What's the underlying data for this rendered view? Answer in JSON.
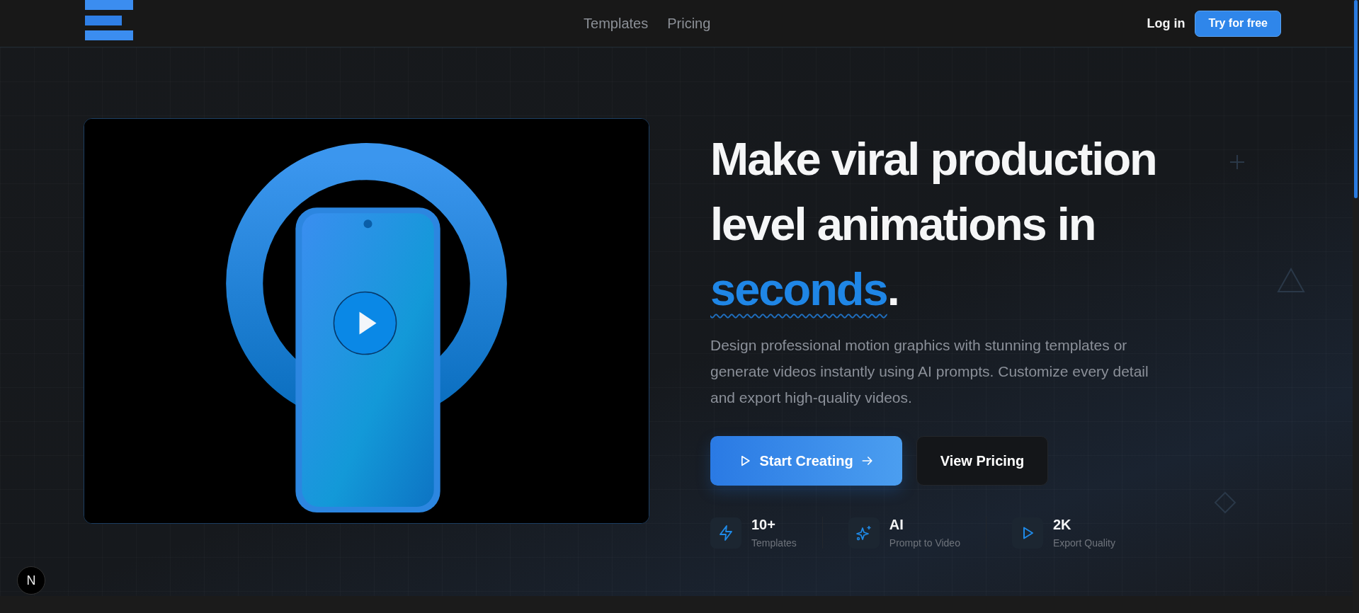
{
  "nav": {
    "links": [
      {
        "label": "Templates"
      },
      {
        "label": "Pricing"
      }
    ],
    "login": "Log in",
    "cta": "Try for free"
  },
  "hero": {
    "headline": {
      "text": "Make viral production level animations in",
      "highlight": "seconds",
      "end": "."
    },
    "description": "Design professional motion graphics with stunning templates or generate videos instantly using AI prompts. Customize every detail and export high-quality videos.",
    "buttons": [
      {
        "label": "Start Creating",
        "kind": "primary"
      },
      {
        "label": "View Pricing",
        "kind": "secondary"
      }
    ],
    "stats": [
      {
        "value": "10+",
        "label": "Templates"
      },
      {
        "value": "AI",
        "label": "Prompt to Video"
      },
      {
        "value": "2K",
        "label": "Export Quality"
      }
    ]
  },
  "dev_badge": {
    "label": "N"
  }
}
